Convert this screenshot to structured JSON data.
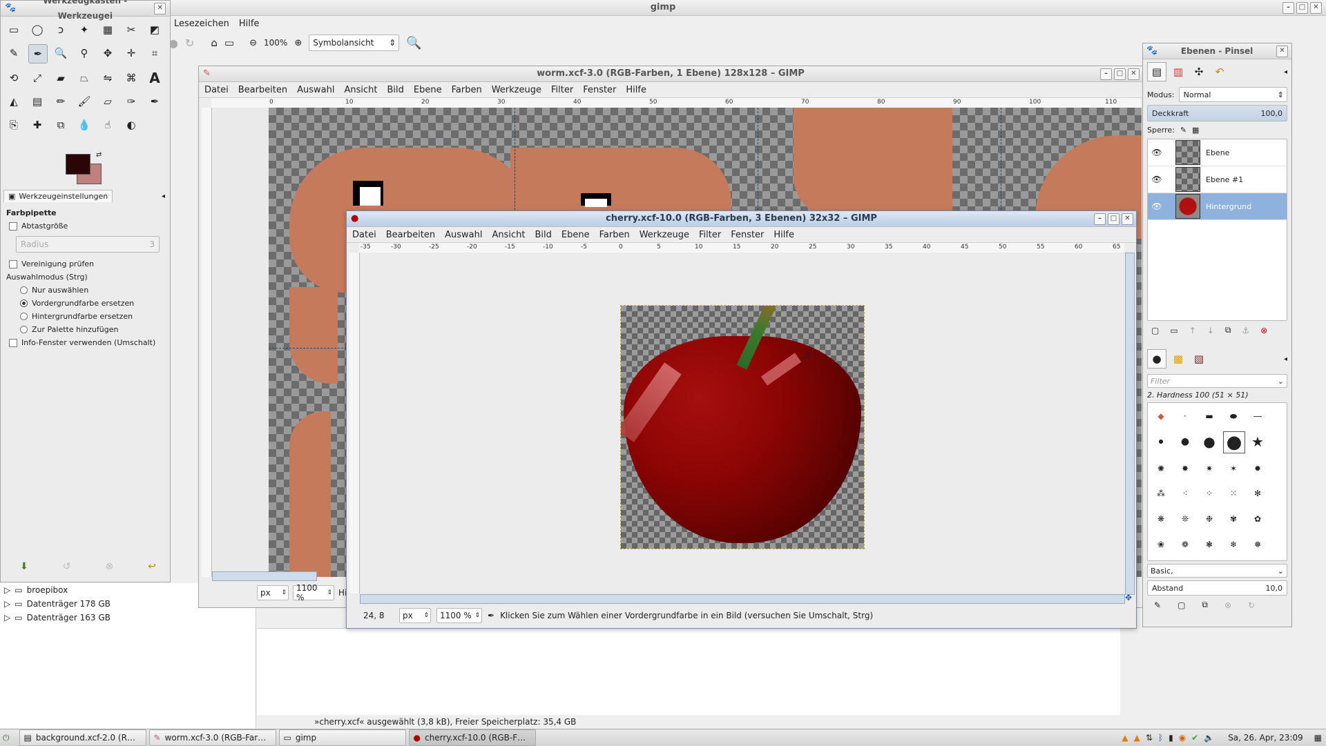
{
  "desktop": {
    "title": "gimp",
    "menu": [
      "Lesezeichen",
      "Hilfe"
    ],
    "zoom": "100%",
    "view_mode": "Symbolansicht",
    "statusbar": "»cherry.xcf« ausgewählt (3,8 kB), Freier Speicherplatz: 35,4 GB",
    "tree": [
      {
        "label": "broepibox"
      },
      {
        "label": "Datenträger 178 GB"
      },
      {
        "label": "Datenträger 163 GB"
      }
    ]
  },
  "toolbox": {
    "title": "Werkzeugkasten - Werkzeugei",
    "tab": "Werkzeugeinstellungen",
    "tool_name": "Farbpipette",
    "sample_avg": "Abtastgröße",
    "radius_placeholder": "Radius",
    "radius_value": "3",
    "merged": "Vereinigung prüfen",
    "mode_heading": "Auswahlmodus (Strg)",
    "modes": [
      "Nur auswählen",
      "Vordergrundfarbe ersetzen",
      "Hintergrundfarbe ersetzen",
      "Zur Palette hinzufügen"
    ],
    "info_window": "Info-Fenster verwenden (Umschalt)",
    "fg_color": "#2a0606",
    "bg_color": "#c08080"
  },
  "worm": {
    "title": "worm.xcf-3.0 (RGB-Farben, 1 Ebene) 128x128 – GIMP",
    "menu": [
      "Datei",
      "Bearbeiten",
      "Auswahl",
      "Ansicht",
      "Bild",
      "Ebene",
      "Farben",
      "Werkzeuge",
      "Filter",
      "Fenster",
      "Hilfe"
    ],
    "ruler": [
      "0",
      "10",
      "20",
      "30",
      "40",
      "50",
      "60",
      "70",
      "80",
      "90",
      "100",
      "110"
    ],
    "unit": "px",
    "zoom": "1100 %",
    "status": "Hi"
  },
  "cherry": {
    "title": "cherry.xcf-10.0 (RGB-Farben, 3 Ebenen) 32x32 – GIMP",
    "menu": [
      "Datei",
      "Bearbeiten",
      "Auswahl",
      "Ansicht",
      "Bild",
      "Ebene",
      "Farben",
      "Werkzeuge",
      "Filter",
      "Fenster",
      "Hilfe"
    ],
    "ruler": [
      "-35",
      "-30",
      "-25",
      "-20",
      "-15",
      "-10",
      "-5",
      "0",
      "5",
      "10",
      "15",
      "20",
      "25",
      "30",
      "35",
      "40",
      "45",
      "50",
      "55",
      "60",
      "65"
    ],
    "coords": "24, 8",
    "unit": "px",
    "zoom": "1100 %",
    "status": "Klicken Sie zum Wählen einer Vordergrundfarbe in ein Bild (versuchen Sie Umschalt, Strg)"
  },
  "layers": {
    "title": "Ebenen - Pinsel",
    "mode_label": "Modus:",
    "mode_value": "Normal",
    "opacity_label": "Deckkraft",
    "opacity_value": "100,0",
    "lock_label": "Sperre:",
    "items": [
      {
        "name": "Ebene"
      },
      {
        "name": "Ebene #1"
      },
      {
        "name": "Hintergrund"
      }
    ],
    "filter_placeholder": "Filter",
    "brush_name": "2. Hardness 100 (51 × 51)",
    "brush_set": "Basic,",
    "spacing_label": "Abstand",
    "spacing_value": "10,0"
  },
  "taskbar": {
    "tasks": [
      "background.xcf-2.0 (R…",
      "worm.xcf-3.0 (RGB-Far…",
      "gimp",
      "cherry.xcf-10.0 (RGB-F…"
    ],
    "clock": "Sa, 26. Apr, 23:09"
  }
}
